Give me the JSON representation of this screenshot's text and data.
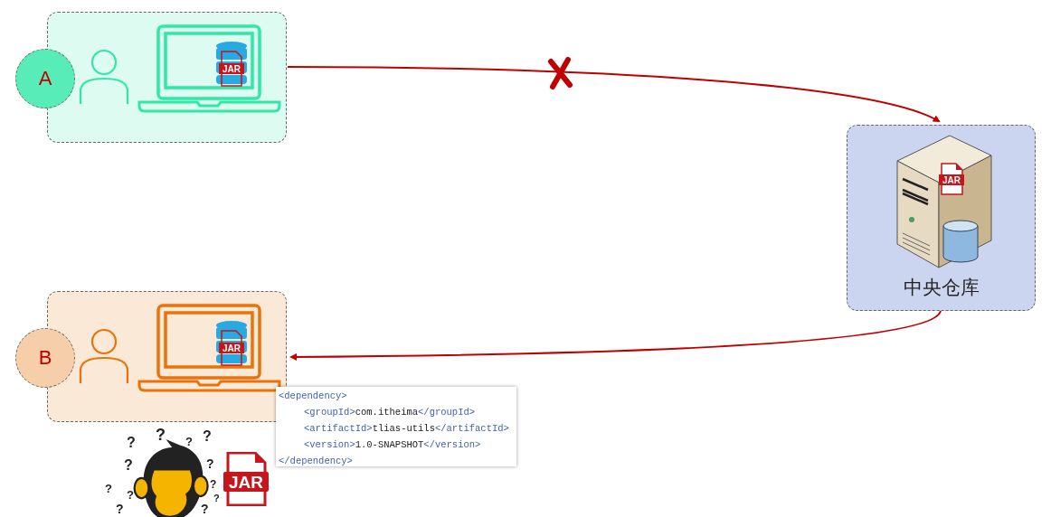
{
  "developers": [
    {
      "badge": "A",
      "color": "#2ee8a6",
      "jar": "JAR"
    },
    {
      "badge": "B",
      "color": "#e8730c",
      "jar": "JAR"
    }
  ],
  "repository": {
    "label": "中央仓库",
    "jar": "JAR"
  },
  "links": [
    {
      "kind": "upload",
      "blocked": true
    },
    {
      "kind": "download",
      "blocked": false
    }
  ],
  "dependency": {
    "open": "<dependency>",
    "close": "</dependency>",
    "children": [
      {
        "open": "<groupId>",
        "value": "com.itheima",
        "close": "</groupId>"
      },
      {
        "open": "<artifactId>",
        "value": "tlias-utils",
        "close": "</artifactId>"
      },
      {
        "open": "<version>",
        "value": "1.0-SNAPSHOT",
        "close": "</version>"
      }
    ]
  },
  "confusion": {
    "marks": [
      "?",
      "?",
      "?",
      "?",
      "?",
      "?",
      "?",
      "?",
      "?",
      "?",
      "?",
      "?"
    ],
    "jar": "JAR"
  }
}
